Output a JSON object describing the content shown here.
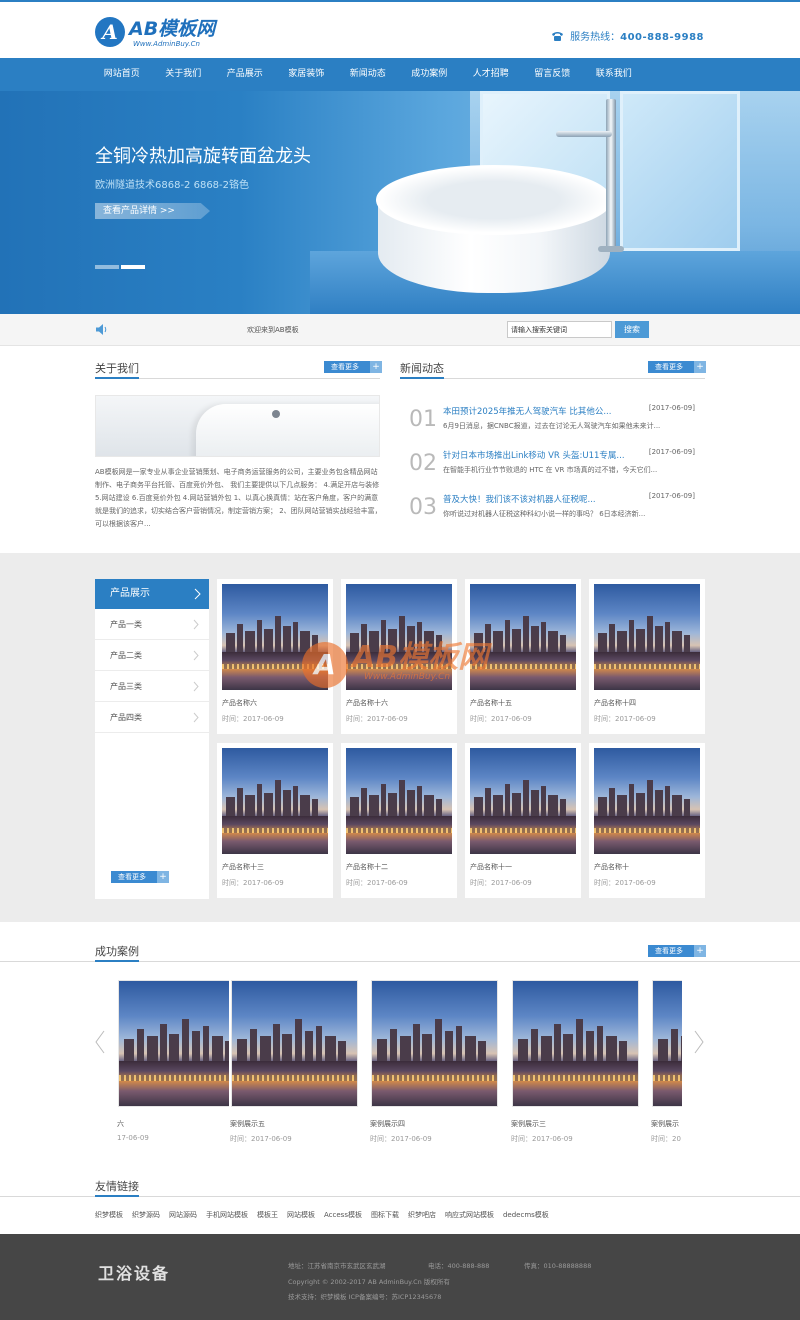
{
  "header": {
    "logo_letter": "A",
    "logo_title": "AB模板网",
    "logo_url": "Www.AdminBuy.Cn",
    "hotline_label": "服务热线：",
    "hotline_number": "400-888-9988"
  },
  "nav": [
    "网站首页",
    "关于我们",
    "产品展示",
    "家居装饰",
    "新闻动态",
    "成功案例",
    "人才招聘",
    "留言反馈",
    "联系我们"
  ],
  "banner": {
    "title": "全铜冷热加高旋转面盆龙头",
    "subtitle": "欧洲隧道技术6868-2 6868-2铬色",
    "button": "查看产品详情 >>"
  },
  "search": {
    "notice": "欢迎来到AB模板",
    "placeholder": "请输入搜索关键词",
    "button": "搜索"
  },
  "about": {
    "title": "关于我们",
    "more": "查看更多",
    "text": "AB模板网是一家专业从事企业营销策划、电子商务运营服务的公司，主要业务包含精品网站制作、电子商务平台托管、百度竞价外包、 我们主要提供以下几点服务：  4.满足开店与装修 5.网站建设 6.百度竞价外包 4.网站营销外包 1、以真心换真情：站在客户角度，客户的满意就是我们的追求，切实结合客户营销情况，制定营销方案； 2、团队网站营销实战经验丰富，可以根据该客户..."
  },
  "news": {
    "title": "新闻动态",
    "more": "查看更多",
    "items": [
      {
        "num": "01",
        "title": "本田预计2025年推无人驾驶汽车 比其他公...",
        "date": "[2017-06-09]",
        "desc": "6月9日消息，据CNBC报道，过去在讨论无人驾驶汽车如果他未来计..."
      },
      {
        "num": "02",
        "title": "针对日本市场推出Link移动 VR 头盔:U11专属...",
        "date": "[2017-06-09]",
        "desc": "在智能手机行业节节败退的 HTC 在 VR 市场真的过不错，今天它们..."
      },
      {
        "num": "03",
        "title": "普及大快！我们该不该对机器人征税呢...",
        "date": "[2017-06-09]",
        "desc": "你听说过对机器人征税这种科幻小说一样的事吗？ 6日本经济新..."
      }
    ]
  },
  "products": {
    "sidebar_title": "产品展示",
    "categories": [
      "产品一类",
      "产品二类",
      "产品三类",
      "产品四类"
    ],
    "more": "查看更多",
    "time_label": "时间：",
    "items": [
      {
        "name": "产品名称六",
        "date": "2017-06-09"
      },
      {
        "name": "产品名称十六",
        "date": "2017-06-09"
      },
      {
        "name": "产品名称十五",
        "date": "2017-06-09"
      },
      {
        "name": "产品名称十四",
        "date": "2017-06-09"
      },
      {
        "name": "产品名称十三",
        "date": "2017-06-09"
      },
      {
        "name": "产品名称十二",
        "date": "2017-06-09"
      },
      {
        "name": "产品名称十一",
        "date": "2017-06-09"
      },
      {
        "name": "产品名称十",
        "date": "2017-06-09"
      }
    ]
  },
  "watermark": {
    "mark": "A",
    "title": "AB模板网",
    "url": "Www.AdminBuy.Cn"
  },
  "cases": {
    "title": "成功案例",
    "more": "查看更多",
    "items": [
      {
        "name": "六",
        "time": "17-06-09"
      },
      {
        "name": "案例展示五",
        "time": "时间：2017-06-09"
      },
      {
        "name": "案例展示四",
        "time": "时间：2017-06-09"
      },
      {
        "name": "案例展示三",
        "time": "时间：2017-06-09"
      },
      {
        "name": "案例展示",
        "time": "时间：20"
      }
    ]
  },
  "friend_links": {
    "title": "友情链接",
    "items": [
      "织梦模板",
      "织梦源码",
      "网站源码",
      "手机网站模板",
      "模板王",
      "网站模板",
      "Access模板",
      "图标下载",
      "织梦吧店",
      "响应式网站模板",
      "dedecms模板"
    ]
  },
  "footer": {
    "brand": "卫浴设备",
    "address": "地址：江苏省南京市玄武区玄武湖",
    "phone": "电话：400-888-888",
    "fax": "传真：010-88888888",
    "copyright": "Copyright © 2002-2017 AB AdminBuy.Cn 版权所有",
    "tech": "技术支持：织梦模板  ICP备案编号：苏ICP12345678"
  },
  "colors": {
    "primary": "#2b7fc3",
    "footer": "#464646",
    "product_bg": "#ececec"
  }
}
